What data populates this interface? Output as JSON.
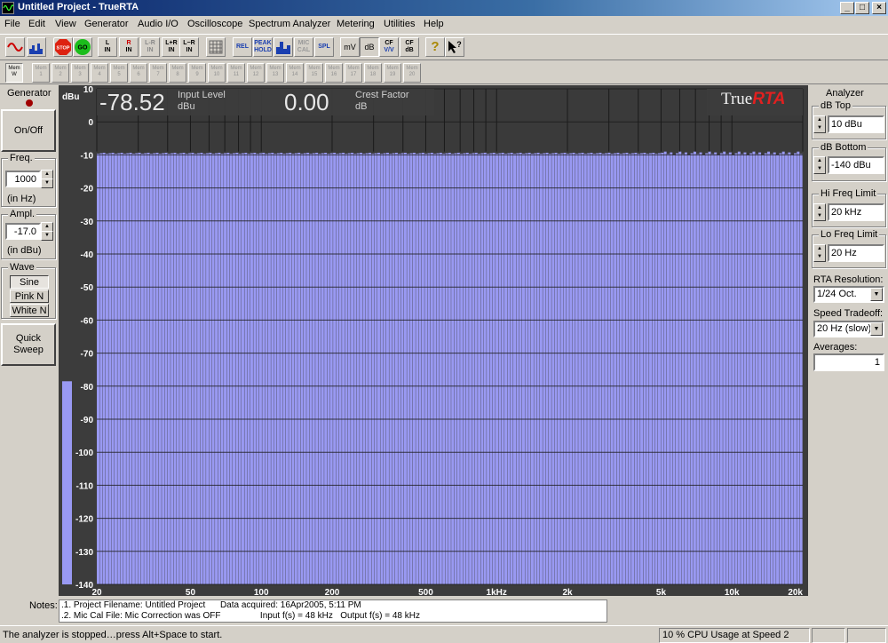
{
  "window": {
    "title": "Untitled Project - TrueRTA"
  },
  "menu": [
    "File",
    "Edit",
    "View",
    "Generator",
    "Audio I/O",
    "Oscilloscope",
    "Spectrum Analyzer",
    "Metering",
    "Utilities",
    "Help"
  ],
  "toolbar": {
    "buttons": [
      "L\nIN",
      "R\nIN",
      "L-R\nIN",
      "L+R\nIN",
      "L-R\nIN",
      "REL",
      "PEAK\nHOLD",
      "MIC\nCAL",
      "SPL",
      "mV",
      "dB",
      "CF\nV/V",
      "CF\ndB"
    ],
    "stop": "STOP",
    "go": "GO"
  },
  "memory": {
    "labels": [
      "Mem\nW",
      "Mem\n1",
      "Mem\n2",
      "Mem\n3",
      "Mem\n4",
      "Mem\n5",
      "Mem\n6",
      "Mem\n7",
      "Mem\n8",
      "Mem\n9",
      "Mem\n10",
      "Mem\n11",
      "Mem\n12",
      "Mem\n13",
      "Mem\n14",
      "Mem\n15",
      "Mem\n16",
      "Mem\n17",
      "Mem\n18",
      "Mem\n19",
      "Mem\n20"
    ]
  },
  "generator": {
    "title": "Generator",
    "onoff": "On/Off",
    "freq_label": "Freq.",
    "freq_value": "1000",
    "freq_unit": "(in Hz)",
    "ampl_label": "Ampl.",
    "ampl_value": "-17.0",
    "ampl_unit": "(in dBu)",
    "wave_label": "Wave",
    "waves": [
      "Sine",
      "Pink N",
      "White N"
    ],
    "quick_sweep": "Quick\nSweep"
  },
  "readout": {
    "input_value": "-78.52",
    "input_label": "Input Level",
    "input_unit": "dBu",
    "crest_value": "0.00",
    "crest_label": "Crest Factor",
    "crest_unit": "dB",
    "logo_a": "True",
    "logo_b": "RTA"
  },
  "chart_data": {
    "type": "bar",
    "ylabel": "dBu",
    "ylim": [
      -140,
      10
    ],
    "y_ticks": [
      10,
      0,
      -10,
      -20,
      -30,
      -40,
      -50,
      -60,
      -70,
      -80,
      -90,
      -100,
      -110,
      -120,
      -130,
      -140
    ],
    "x_scale": "log",
    "xlim": [
      20,
      20000
    ],
    "x_ticks": [
      {
        "v": 20,
        "label": "20"
      },
      {
        "v": 50,
        "label": "50"
      },
      {
        "v": 100,
        "label": "100"
      },
      {
        "v": 200,
        "label": "200"
      },
      {
        "v": 500,
        "label": "500"
      },
      {
        "v": 1000,
        "label": "1kHz"
      },
      {
        "v": 2000,
        "label": "2k"
      },
      {
        "v": 5000,
        "label": "5k"
      },
      {
        "v": 10000,
        "label": "10k"
      },
      {
        "v": 20000,
        "label": "20k"
      }
    ],
    "level_bar_value": -78.52,
    "spectrum_level": -9.5,
    "bars_per_octave": 24,
    "bar_color": "#9999f2",
    "grid_color": "#1a1a1a"
  },
  "analyzer": {
    "title": "Analyzer",
    "db_top_label": "dB Top",
    "db_top_value": "10 dBu",
    "db_bottom_label": "dB Bottom",
    "db_bottom_value": "-140 dBu",
    "hi_freq_label": "Hi Freq Limit",
    "hi_freq_value": "20 kHz",
    "lo_freq_label": "Lo Freq Limit",
    "lo_freq_value": "20 Hz",
    "resolution_label": "RTA Resolution:",
    "resolution_value": "1/24 Oct.",
    "speed_label": "Speed Tradeoff:",
    "speed_value": "20 Hz (slow)",
    "averages_label": "Averages:",
    "averages_value": "1"
  },
  "notes": {
    "label": "Notes:",
    "line1": ".1. Project Filename: Untitled Project      Data acquired: 16Apr2005, 5:11 PM",
    "line2": ".2. Mic Cal File: Mic Correction was OFF                Input f(s) = 48 kHz   Output f(s) = 48 kHz"
  },
  "status": {
    "message": "The analyzer is stopped…press Alt+Space to start.",
    "cpu": "10 % CPU Usage at Speed 2"
  }
}
